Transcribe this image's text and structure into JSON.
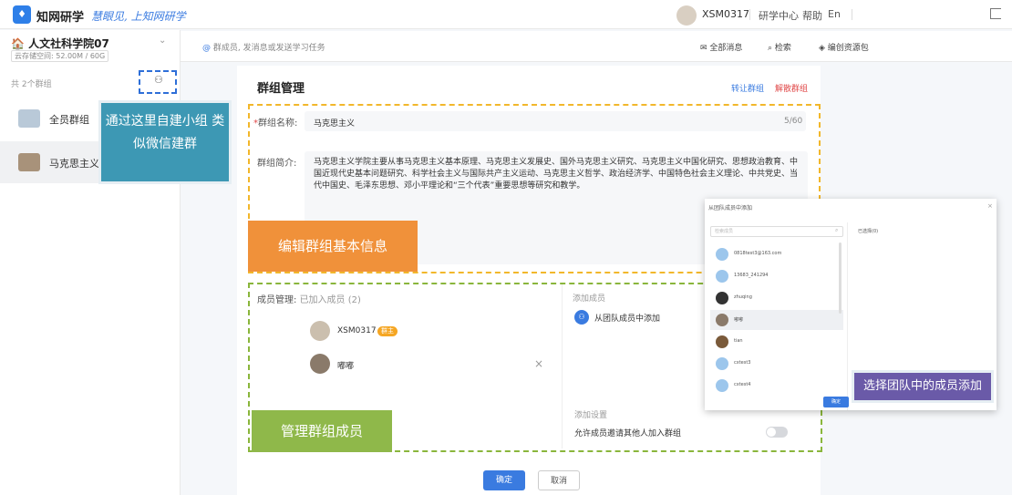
{
  "header": {
    "brand": "知网研学",
    "slogan": "慧眼见, 上知网研学",
    "username": "XSM0317",
    "links": [
      "研学中心",
      "帮助",
      "En"
    ]
  },
  "sidebar": {
    "org_name": "人文社科学院07",
    "storage": "云存储空间: 52.00M / 60G",
    "group_count": "共 2个群组",
    "groups": [
      {
        "label": "全员群组"
      },
      {
        "label": "马克思主义"
      }
    ],
    "tip": "通过这里自建小组 类似微信建群"
  },
  "search": {
    "placeholder": "群成员, 发消息或发送学习任务",
    "all_messages": "全部消息",
    "search": "检索",
    "resource": "编创资源包"
  },
  "panel": {
    "title": "群组管理",
    "transfer": "转让群组",
    "dissolve": "解散群组",
    "name_label": "群组名称:",
    "name_value": "马克思主义",
    "name_counter": "5/60",
    "intro_label": "群组简介:",
    "intro_value": "马克思主义学院主要从事马克思主义基本原理、马克思主义发展史、国外马克思主义研究、马克思主义中国化研究、思想政治教育、中国近现代史基本问题研究、科学社会主义与国际共产主义运动、马克思主义哲学、政治经济学、中国特色社会主义理论、中共党史、当代中国史、毛泽东思想、邓小平理论和“三个代表”重要思想等研究和教学。",
    "edit_label": "编辑群组基本信息",
    "member_label": "成员管理:",
    "member_count": "已加入成员 (2)",
    "members": [
      {
        "name": "XSM0317",
        "badge": "群主"
      },
      {
        "name": "嘟嘟"
      }
    ],
    "add_member": "添加成员",
    "add_from_team": "从团队成员中添加",
    "add_settings": "添加设置",
    "allow_invite": "允许成员邀请其他人加入群组",
    "manage_label": "管理群组成员",
    "confirm": "确定",
    "cancel": "取消"
  },
  "popup": {
    "title": "从团队成员中添加",
    "search_placeholder": "检索成员",
    "selected": "已选择(0)",
    "members": [
      "0818test3@163.com",
      "13683_241294",
      "zhuqing",
      "嘟嘟",
      "tian",
      "cxtest3",
      "cxtest4"
    ],
    "confirm": "确定",
    "tip": "选择团队中的成员添加"
  },
  "colors": {
    "accent": "#3a7be0",
    "danger": "#e04848",
    "tip_blue": "#3d98b4",
    "tip_orange": "#f0913a",
    "tip_green": "#8fb84a",
    "tip_purple": "#6a5aa8"
  }
}
